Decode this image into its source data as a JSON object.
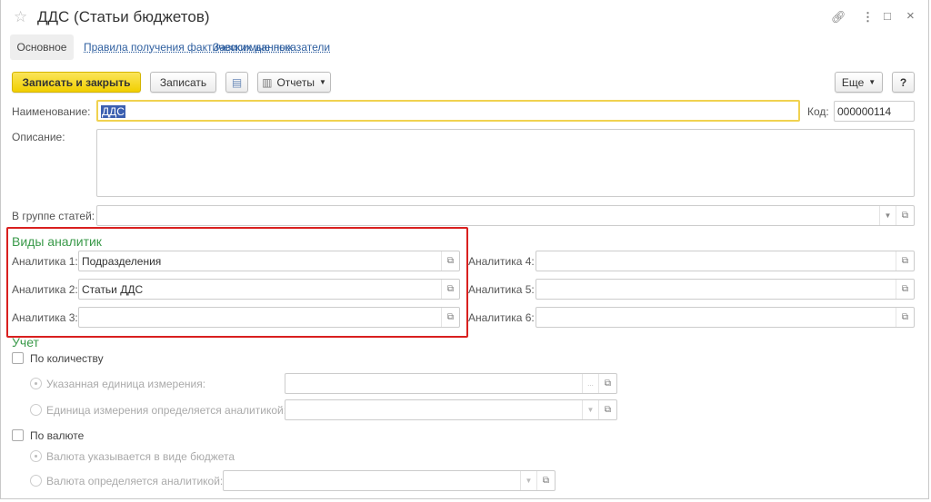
{
  "title": "ДДС (Статьи бюджетов)",
  "tabs": {
    "main": "Основное",
    "rules": "Правила получения фактических данных",
    "dependent": "Зависимые показатели"
  },
  "toolbar": {
    "save_close": "Записать и закрыть",
    "save": "Записать",
    "reports": "Отчеты",
    "more": "Еще",
    "help": "?"
  },
  "fields": {
    "name_label": "Наименование:",
    "name_value": "ДДС",
    "code_label": "Код:",
    "code_value": "000000114",
    "description_label": "Описание:",
    "group_label": "В группе статей:"
  },
  "analytics": {
    "title": "Виды аналитик",
    "items": [
      {
        "label": "Аналитика 1:",
        "value": "Подразделения"
      },
      {
        "label": "Аналитика 2:",
        "value": "Статьи ДДС"
      },
      {
        "label": "Аналитика 3:",
        "value": ""
      },
      {
        "label": "Аналитика 4:",
        "value": ""
      },
      {
        "label": "Аналитика 5:",
        "value": ""
      },
      {
        "label": "Аналитика 6:",
        "value": ""
      }
    ]
  },
  "accounting": {
    "title": "Учет",
    "by_quantity": "По количеству",
    "unit_specified": "Указанная единица измерения:",
    "unit_by_analytic": "Единица измерения определяется аналитикой:",
    "by_currency": "По валюте",
    "currency_in_budget": "Валюта указывается в виде бюджета",
    "currency_by_analytic": "Валюта определяется аналитикой:",
    "ellipsis": "..."
  },
  "colors": {
    "accent": "#f5d800",
    "highlight_box": "#d9201f",
    "section": "#3a9a4a"
  }
}
